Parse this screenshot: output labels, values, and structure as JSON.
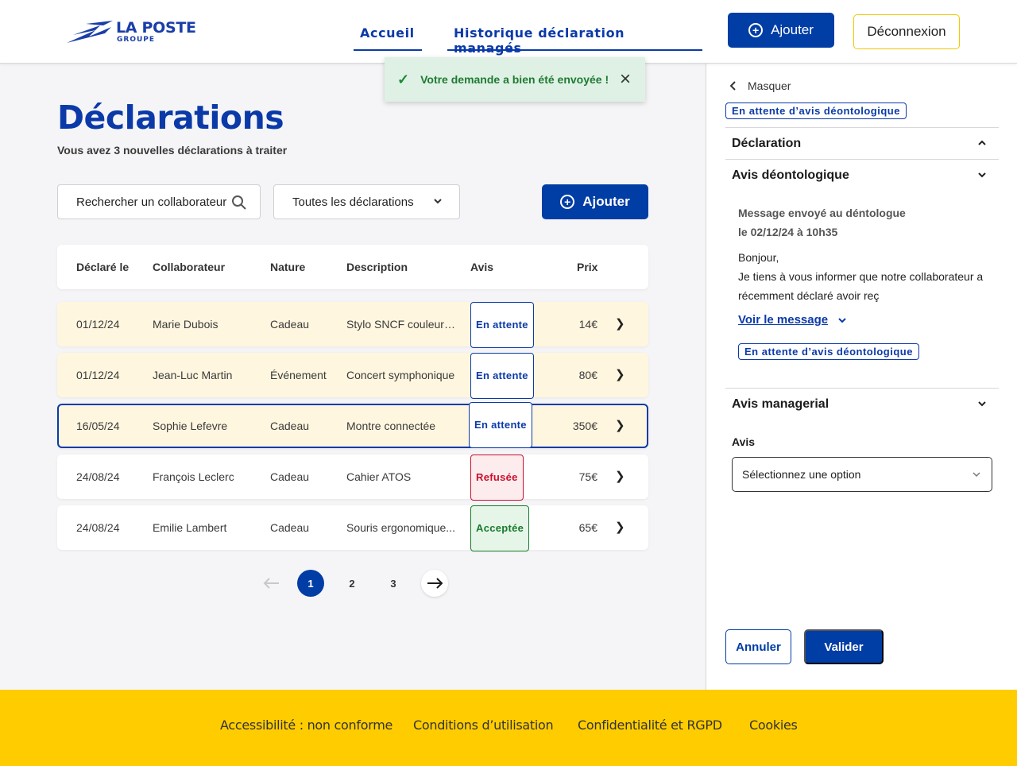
{
  "header": {
    "brand": "LA POSTE",
    "brand_sub": "GROUPE",
    "nav": [
      "Accueil",
      "Historique déclaration managés"
    ],
    "add_label": "Ajouter",
    "logout_label": "Déconnexion"
  },
  "toast": {
    "message": "Votre demande a bien été envoyée !"
  },
  "main": {
    "title": "Déclarations",
    "subtitle": "Vous avez 3 nouvelles déclarations à traiter",
    "search_value": "Rechercher un collaborateur",
    "filter_value": "Toutes les déclarations",
    "add_label": "Ajouter",
    "columns": [
      "Déclaré le",
      "Collaborateur",
      "Nature",
      "Description",
      "Avis",
      "Prix"
    ],
    "rows": [
      {
        "date": "01/12/24",
        "name": "Marie Dubois",
        "nature": "Cadeau",
        "desc": "Stylo SNCF couleur r...",
        "status": "En attente",
        "price": "14€"
      },
      {
        "date": "01/12/24",
        "name": "Jean-Luc Martin",
        "nature": "Événement",
        "desc": "Concert symphonique",
        "status": "En attente",
        "price": "80€"
      },
      {
        "date": "16/05/24",
        "name": "Sophie Lefevre",
        "nature": "Cadeau",
        "desc": "Montre connectée",
        "status": "En attente",
        "price": "350€"
      },
      {
        "date": "24/08/24",
        "name": "François Leclerc",
        "nature": "Cadeau",
        "desc": "Cahier ATOS",
        "status": "Refusée",
        "price": "75€"
      },
      {
        "date": "24/08/24",
        "name": "Emilie Lambert",
        "nature": "Cadeau",
        "desc": "Souris ergonomique...",
        "status": "Acceptée",
        "price": "65€"
      }
    ],
    "pages": [
      "1",
      "2",
      "3"
    ]
  },
  "panel": {
    "hide_label": "Masquer",
    "status_chip": "En attente  d’avis déontologique",
    "section_declaration": "Déclaration",
    "section_avis_deonto": "Avis déontologique",
    "msg_sent": "Message envoyé au déntologue",
    "msg_date": "le 02/12/24 à 10h35",
    "msg_greeting": "Bonjour,",
    "msg_text": "Je tiens à vous informer que notre collaborateur a récemment déclaré avoir reç",
    "see_message": "Voir le message",
    "status_chip2": "En attente  d’avis déontologique",
    "section_avis_manager": "Avis managerial",
    "avis_label": "Avis",
    "select_placeholder": "Sélectionnez une option",
    "cancel_label": "Annuler",
    "validate_label": "Valider"
  },
  "footer": {
    "links": [
      "Accessibilité : non conforme",
      "Conditions d’utilisation",
      "Confidentialité et RGPD",
      "Cookies"
    ]
  },
  "colors": {
    "primary": "#003da5",
    "footer": "#ffcc00",
    "pending_row": "#fff6df"
  }
}
